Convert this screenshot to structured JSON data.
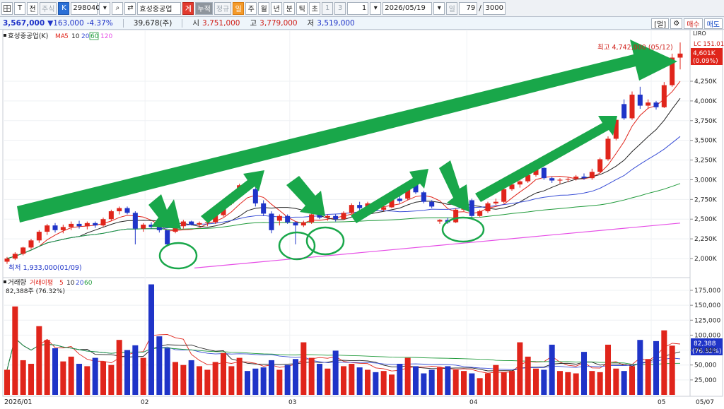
{
  "toolbar": {
    "btn_t": "T",
    "btn_jeon": "전",
    "tab_stock": "주식",
    "btn_k": "K",
    "code": "298040",
    "name": "효성중공업",
    "btn_gong": "계",
    "btn_nuljeok": "누적",
    "btn_jeonggu": "정규",
    "period_il": "일",
    "period_ju": "주",
    "period_wol": "월",
    "period_nyeon": "년",
    "period_bun": "분",
    "period_tik": "틱",
    "period_cho": "초",
    "num1": "1",
    "num3": "3",
    "num_select": "1",
    "date": "2026/05/19",
    "unit": "일",
    "count": "79",
    "slash": "/",
    "total": "3000"
  },
  "quote": {
    "price": "3,567,000",
    "change": "▼163,000",
    "change_pct": "-4.37%",
    "volume": "39,678(주)",
    "open_label": "시",
    "open": "3,751,000",
    "high_label": "고",
    "high": "3,779,000",
    "low_label": "저",
    "low": "3,519,000"
  },
  "right_buttons": {
    "layout": "[멀]",
    "gear": "⚙",
    "buy": "매수",
    "sell": "매도"
  },
  "legend": {
    "name": "효성중공업(K)",
    "ma_label": "MA",
    "ma": [
      {
        "label": "5",
        "color": "#e0251b"
      },
      {
        "label": "10",
        "color": "#222222"
      },
      {
        "label": "20",
        "color": "#3a4fd6"
      },
      {
        "label": "60",
        "color": "#1f9a3a"
      },
      {
        "label": "120",
        "color": "#e64fe6"
      }
    ]
  },
  "price_panel": {
    "lc_label": "LC 151.01%",
    "current_tag": "4,601K",
    "current_pct": "(0.09%)",
    "high_annotation": "최고 4,742,000 (05/12)",
    "low_annotation": "최저 1,933,000(01/09)",
    "y_ticks": [
      "4,250K",
      "4,000K",
      "3,750K",
      "3,500K",
      "3,250K",
      "3,000K",
      "2,750K",
      "2,500K",
      "2,250K",
      "2,000K"
    ],
    "top_label": "LIRO"
  },
  "volume_panel": {
    "title": "거래량",
    "ma_label": "거래이평",
    "ma": [
      {
        "label": "5",
        "color": "#e0251b"
      },
      {
        "label": "10",
        "color": "#222222"
      },
      {
        "label": "20",
        "color": "#3a4fd6"
      },
      {
        "label": "60",
        "color": "#1f9a3a"
      }
    ],
    "current": "82,388주 (76.32%)",
    "tag_value": "82,388",
    "tag_pct": "(76.32%)",
    "y_ticks": [
      "175,000",
      "150,000",
      "125,000",
      "100,000",
      "75,000",
      "50,000",
      "25,000"
    ]
  },
  "x_axis": {
    "start": "2026/01",
    "m02": "02",
    "m03": "03",
    "m04": "04",
    "m05": "05",
    "end": "05/07"
  },
  "colors": {
    "up": "#e0251b",
    "down": "#1f34c8",
    "arrow": "#19a74a",
    "circle": "#19a74a"
  },
  "chart_data": {
    "type": "candlestick",
    "y_unit": "KRW",
    "ylim": [
      1900000,
      4800000
    ],
    "candles": [
      [
        1960000,
        2020000,
        1933000,
        2000000
      ],
      [
        2000000,
        2080000,
        1980000,
        2060000
      ],
      [
        2060000,
        2150000,
        2040000,
        2140000
      ],
      [
        2140000,
        2250000,
        2120000,
        2230000
      ],
      [
        2230000,
        2360000,
        2200000,
        2340000
      ],
      [
        2340000,
        2440000,
        2300000,
        2420000
      ],
      [
        2420000,
        2450000,
        2330000,
        2360000
      ],
      [
        2360000,
        2430000,
        2320000,
        2400000
      ],
      [
        2400000,
        2470000,
        2360000,
        2440000
      ],
      [
        2440000,
        2480000,
        2380000,
        2410000
      ],
      [
        2410000,
        2470000,
        2370000,
        2450000
      ],
      [
        2450000,
        2470000,
        2390000,
        2420000
      ],
      [
        2420000,
        2520000,
        2400000,
        2500000
      ],
      [
        2500000,
        2620000,
        2480000,
        2600000
      ],
      [
        2600000,
        2660000,
        2560000,
        2640000
      ],
      [
        2640000,
        2660000,
        2560000,
        2580000
      ],
      [
        2580000,
        2600000,
        2180000,
        2380000
      ],
      [
        2380000,
        2450000,
        2340000,
        2430000
      ],
      [
        2430000,
        2460000,
        2380000,
        2400000
      ],
      [
        2400000,
        2420000,
        2330000,
        2360000
      ],
      [
        2360000,
        2300000,
        2160000,
        2180000
      ],
      [
        2340000,
        2430000,
        2320000,
        2410000
      ],
      [
        2410000,
        2490000,
        2380000,
        2470000
      ],
      [
        2470000,
        2480000,
        2420000,
        2430000
      ],
      [
        2430000,
        2470000,
        2410000,
        2450000
      ],
      [
        2450000,
        2480000,
        2410000,
        2460000
      ],
      [
        2460000,
        2560000,
        2440000,
        2550000
      ],
      [
        2550000,
        2720000,
        2530000,
        2700000
      ],
      [
        2700000,
        2820000,
        2680000,
        2800000
      ],
      [
        2800000,
        2950000,
        2780000,
        2930000
      ],
      [
        2930000,
        2980000,
        2850000,
        2880000
      ],
      [
        2880000,
        2900000,
        2660000,
        2700000
      ],
      [
        2700000,
        2740000,
        2540000,
        2570000
      ],
      [
        2570000,
        2600000,
        2320000,
        2360000
      ],
      [
        2480000,
        2560000,
        2420000,
        2540000
      ],
      [
        2540000,
        2560000,
        2440000,
        2460000
      ],
      [
        2460000,
        2470000,
        2180000,
        2420000
      ],
      [
        2420000,
        2480000,
        2400000,
        2460000
      ],
      [
        2460000,
        2580000,
        2440000,
        2560000
      ],
      [
        2560000,
        2610000,
        2500000,
        2520000
      ],
      [
        2520000,
        2560000,
        2480000,
        2540000
      ],
      [
        2540000,
        2560000,
        2470000,
        2500000
      ],
      [
        2500000,
        2600000,
        2490000,
        2580000
      ],
      [
        2580000,
        2700000,
        2560000,
        2680000
      ],
      [
        2680000,
        2720000,
        2600000,
        2640000
      ],
      [
        2640000,
        2720000,
        2620000,
        2700000
      ],
      [
        2700000,
        2730000,
        2600000,
        2620000
      ],
      [
        2620000,
        2680000,
        2600000,
        2650000
      ],
      [
        2650000,
        2780000,
        2640000,
        2760000
      ],
      [
        2760000,
        2800000,
        2700000,
        2730000
      ],
      [
        2760000,
        2960000,
        2740000,
        2950000
      ],
      [
        2950000,
        2980000,
        2820000,
        2840000
      ],
      [
        2840000,
        2860000,
        2700000,
        2720000
      ],
      [
        2720000,
        2740000,
        2640000,
        2660000
      ],
      [
        2470000,
        2500000,
        2440000,
        2490000
      ],
      [
        2490000,
        2520000,
        2440000,
        2460000
      ],
      [
        2460000,
        2640000,
        2450000,
        2620000
      ],
      [
        2620000,
        2760000,
        2600000,
        2740000
      ],
      [
        2740000,
        2760000,
        2520000,
        2540000
      ],
      [
        2540000,
        2620000,
        2530000,
        2600000
      ],
      [
        2600000,
        2720000,
        2580000,
        2700000
      ],
      [
        2700000,
        2760000,
        2680000,
        2720000
      ],
      [
        2720000,
        2900000,
        2700000,
        2880000
      ],
      [
        2880000,
        2960000,
        2860000,
        2940000
      ],
      [
        2940000,
        3000000,
        2900000,
        2980000
      ],
      [
        2980000,
        3080000,
        2960000,
        3060000
      ],
      [
        3060000,
        3200000,
        3040000,
        3150000
      ],
      [
        3150000,
        3160000,
        3000000,
        3020000
      ],
      [
        3020000,
        3040000,
        2960000,
        2990000
      ],
      [
        2990000,
        3020000,
        2950000,
        3000000
      ],
      [
        3000000,
        3030000,
        2970000,
        3010000
      ],
      [
        3010000,
        3060000,
        2990000,
        3040000
      ],
      [
        3040000,
        3080000,
        3000000,
        3020000
      ],
      [
        3020000,
        3140000,
        3000000,
        3100000
      ],
      [
        3100000,
        3280000,
        3080000,
        3260000
      ],
      [
        3260000,
        3550000,
        3240000,
        3520000
      ],
      [
        3520000,
        3780000,
        3500000,
        3760000
      ],
      [
        3960000,
        4020000,
        3760000,
        3780000
      ],
      [
        3780000,
        4120000,
        3760000,
        4080000
      ],
      [
        4080000,
        4180000,
        3900000,
        3940000
      ],
      [
        3940000,
        4020000,
        3900000,
        3980000
      ],
      [
        3980000,
        4000000,
        3890000,
        3920000
      ],
      [
        3920000,
        4240000,
        3910000,
        4200000
      ],
      [
        4200000,
        4600000,
        4180000,
        4550000
      ],
      [
        4550000,
        4742000,
        4400000,
        4601000
      ]
    ],
    "volume": [
      42000,
      148000,
      58000,
      52000,
      115000,
      92000,
      78000,
      56000,
      64000,
      52000,
      48000,
      62000,
      56000,
      50000,
      92000,
      75000,
      83000,
      62000,
      185000,
      98000,
      78000,
      55000,
      50000,
      58000,
      48000,
      42000,
      55000,
      70000,
      48000,
      62000,
      40000,
      44000,
      46000,
      58000,
      42000,
      50000,
      60000,
      88000,
      62000,
      52000,
      44000,
      74000,
      48000,
      52000,
      46000,
      42000,
      38000,
      40000,
      34000,
      52000,
      62000,
      48000,
      36000,
      42000,
      46000,
      48000,
      42000,
      40000,
      36000,
      28000,
      36000,
      50000,
      38000,
      40000,
      88000,
      64000,
      44000,
      42000,
      84000,
      40000,
      38000,
      36000,
      72000,
      40000,
      38000,
      84000,
      44000,
      40000,
      48000,
      92000,
      60000,
      90000,
      108000,
      82388
    ],
    "title": "효성중공업(K)",
    "xlabel": "",
    "ylabel": ""
  }
}
